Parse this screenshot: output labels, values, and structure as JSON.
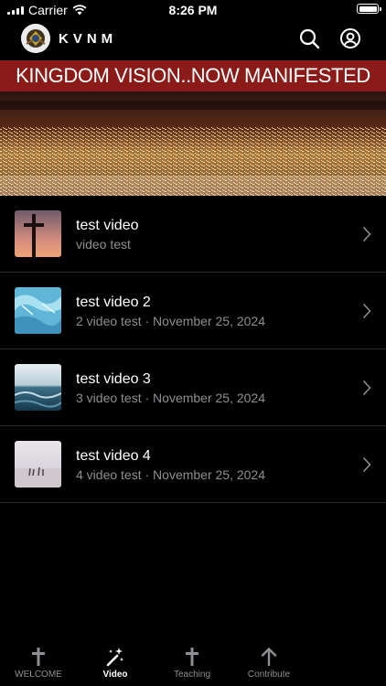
{
  "status_bar": {
    "carrier": "Carrier",
    "time": "8:26 PM"
  },
  "header": {
    "brand": "KVNM"
  },
  "banner": {
    "text": "KINGDOM VISION..NOW MANIFESTED"
  },
  "videos": [
    {
      "title": "test video",
      "subtitle": "video test"
    },
    {
      "title": "test video 2",
      "subtitle": "2 video test · November 25, 2024"
    },
    {
      "title": "test video 3",
      "subtitle": "3 video test · November 25, 2024"
    },
    {
      "title": "test video 4",
      "subtitle": "4 video test · November 25, 2024"
    }
  ],
  "tabs": [
    {
      "label": "WELCOME",
      "icon": "cross-icon",
      "active": false
    },
    {
      "label": "Video",
      "icon": "magic-wand-icon",
      "active": true
    },
    {
      "label": "Teaching",
      "icon": "cross-icon",
      "active": false
    },
    {
      "label": "Contribute",
      "icon": "arrow-up-icon",
      "active": false
    }
  ],
  "colors": {
    "background": "#000000",
    "secondary_text": "#8e8e93",
    "banner_red": "#8a1b18",
    "separator": "#2b2b2d"
  }
}
